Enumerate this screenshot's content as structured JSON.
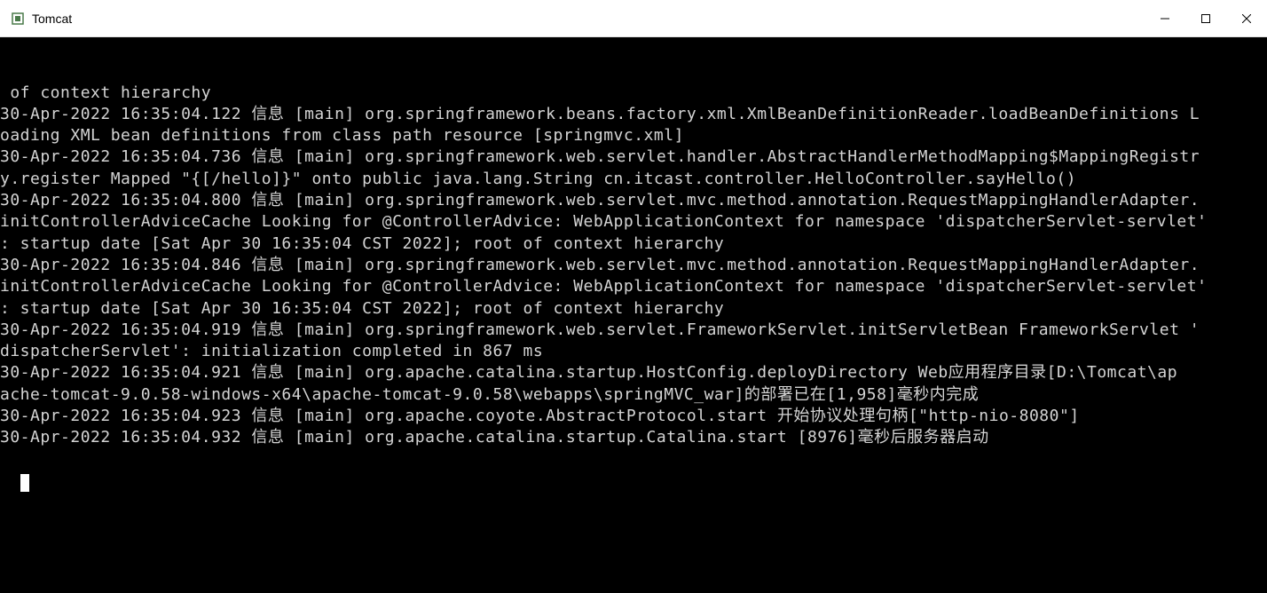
{
  "window": {
    "title": "Tomcat"
  },
  "console": {
    "lines": [
      " of context hierarchy",
      "30-Apr-2022 16:35:04.122 信息 [main] org.springframework.beans.factory.xml.XmlBeanDefinitionReader.loadBeanDefinitions L",
      "oading XML bean definitions from class path resource [springmvc.xml]",
      "30-Apr-2022 16:35:04.736 信息 [main] org.springframework.web.servlet.handler.AbstractHandlerMethodMapping$MappingRegistr",
      "y.register Mapped \"{[/hello]}\" onto public java.lang.String cn.itcast.controller.HelloController.sayHello()",
      "30-Apr-2022 16:35:04.800 信息 [main] org.springframework.web.servlet.mvc.method.annotation.RequestMappingHandlerAdapter.",
      "initControllerAdviceCache Looking for @ControllerAdvice: WebApplicationContext for namespace 'dispatcherServlet-servlet'",
      ": startup date [Sat Apr 30 16:35:04 CST 2022]; root of context hierarchy",
      "30-Apr-2022 16:35:04.846 信息 [main] org.springframework.web.servlet.mvc.method.annotation.RequestMappingHandlerAdapter.",
      "initControllerAdviceCache Looking for @ControllerAdvice: WebApplicationContext for namespace 'dispatcherServlet-servlet'",
      ": startup date [Sat Apr 30 16:35:04 CST 2022]; root of context hierarchy",
      "30-Apr-2022 16:35:04.919 信息 [main] org.springframework.web.servlet.FrameworkServlet.initServletBean FrameworkServlet '",
      "dispatcherServlet': initialization completed in 867 ms",
      "30-Apr-2022 16:35:04.921 信息 [main] org.apache.catalina.startup.HostConfig.deployDirectory Web应用程序目录[D:\\Tomcat\\ap",
      "ache-tomcat-9.0.58-windows-x64\\apache-tomcat-9.0.58\\webapps\\springMVC_war]的部署已在[1,958]毫秒内完成",
      "30-Apr-2022 16:35:04.923 信息 [main] org.apache.coyote.AbstractProtocol.start 开始协议处理句柄[\"http-nio-8080\"]",
      "30-Apr-2022 16:35:04.932 信息 [main] org.apache.catalina.startup.Catalina.start [8976]毫秒后服务器启动"
    ]
  }
}
